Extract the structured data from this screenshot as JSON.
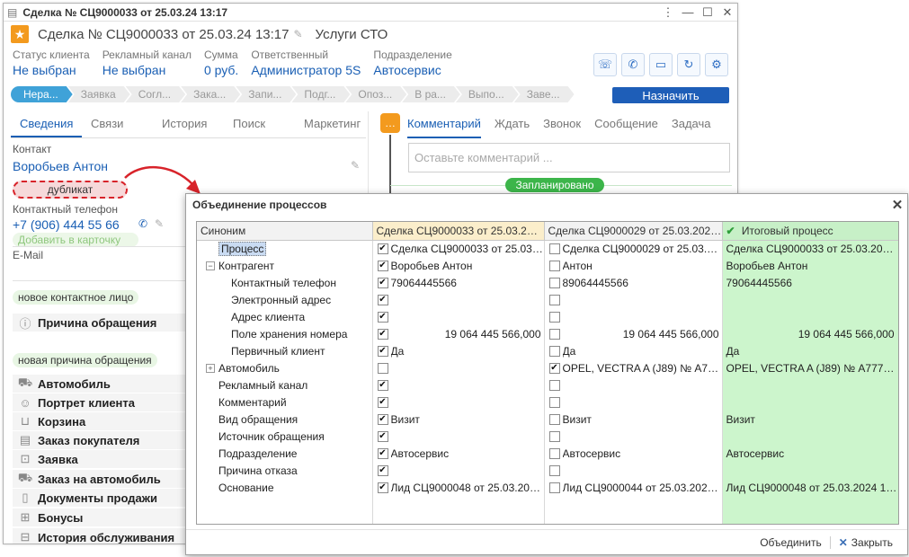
{
  "window": {
    "title": "Сделка № СЦ9000033 от 25.03.24 13:17"
  },
  "header": {
    "doc_title": "Сделка № СЦ9000033 от 25.03.24 13:17",
    "service": "Услуги СТО"
  },
  "fields": [
    {
      "label": "Статус клиента",
      "value": "Не выбран"
    },
    {
      "label": "Рекламный канал",
      "value": "Не выбран"
    },
    {
      "label": "Сумма",
      "value": "0 руб."
    },
    {
      "label": "Ответственный",
      "value": "Администратор 5S"
    },
    {
      "label": "Подразделение",
      "value": "Автосервис"
    }
  ],
  "stages": [
    "Нера...",
    "Заявка",
    "Согл...",
    "Зака...",
    "Запи...",
    "Подг...",
    "Опоз...",
    "В ра...",
    "Выпо...",
    "Заве..."
  ],
  "assign_button": "Назначить",
  "left_tabs": [
    "Сведения",
    "Связи",
    "История",
    "Поиск",
    "Маркетинг"
  ],
  "right_tabs": [
    "Комментарий",
    "Ждать",
    "Звонок",
    "Сообщение",
    "Задача"
  ],
  "comment_placeholder": "Оставьте комментарий ...",
  "planned_label": "Запланировано",
  "contact": {
    "label": "Контакт",
    "name": "Воробьев Антон",
    "duplicate": "дубликат",
    "phone_label": "Контактный телефон",
    "phone": "+7 (906) 444 55 66",
    "add_card": "Добавить в карточку",
    "email_label": "E-Mail",
    "new_contact": "новое контактное лицо",
    "reason_header": "Причина обращения",
    "new_reason": "новая причина обращения"
  },
  "sections": [
    {
      "label": "Автомобиль",
      "icon": "car-icon"
    },
    {
      "label": "Портрет клиента",
      "icon": "person-icon"
    },
    {
      "label": "Корзина",
      "icon": "cart-icon"
    },
    {
      "label": "Заказ покупателя",
      "icon": "document-icon"
    },
    {
      "label": "Заявка",
      "icon": "inbox-icon"
    },
    {
      "label": "Заказ на автомобиль",
      "icon": "car-order-icon"
    },
    {
      "label": "Документы продажи",
      "icon": "clipboard-icon"
    },
    {
      "label": "Бонусы",
      "icon": "gift-icon"
    },
    {
      "label": "История обслуживания",
      "icon": "history-icon"
    }
  ],
  "dialog": {
    "title": "Объединение процессов",
    "columns": {
      "synonym": "Синоним",
      "deal1": "Сделка СЦ9000033 от 25.03.2024 1...",
      "deal2": "Сделка СЦ9000029 от 25.03.2024 11...",
      "final": "Итоговый процесс"
    },
    "rows": [
      {
        "name": "Процесс",
        "level": 0,
        "sel": true,
        "c1": true,
        "v1": "Сделка СЦ9000033 от 25.03.202...",
        "c2": false,
        "v2": "Сделка СЦ9000029 от 25.03.2024 1...",
        "fin": "Сделка СЦ9000033 от 25.03.2024 13:..."
      },
      {
        "name": "Контрагент",
        "level": 0,
        "expand": "−",
        "c1": true,
        "v1": "Воробьев Антон",
        "c2": false,
        "v2": "Антон",
        "fin": "Воробьев Антон"
      },
      {
        "name": "Контактный телефон",
        "level": 1,
        "c1": true,
        "v1": "79064445566",
        "c2": false,
        "v2": "89064445566",
        "fin": "79064445566"
      },
      {
        "name": "Электронный адрес",
        "level": 1,
        "c1": true,
        "v1": "",
        "c2": false,
        "v2": "",
        "fin": ""
      },
      {
        "name": "Адрес клиента",
        "level": 1,
        "c1": true,
        "v1": "",
        "c2": false,
        "v2": "",
        "fin": ""
      },
      {
        "name": "Поле хранения номера",
        "level": 1,
        "c1": true,
        "v1": "19 064 445 566,000",
        "num": true,
        "c2": false,
        "v2": "19 064 445 566,000",
        "fin": "19 064 445 566,000"
      },
      {
        "name": "Первичный клиент",
        "level": 1,
        "c1": true,
        "v1": "Да",
        "c2": false,
        "v2": "Да",
        "fin": "Да"
      },
      {
        "name": "Автомобиль",
        "level": 0,
        "expand": "+",
        "c1": false,
        "v1": "",
        "c2": true,
        "v2": "OPEL, VECTRA A (J89) № А777АА...",
        "fin": "OPEL, VECTRA A (J89) № А777АА77..."
      },
      {
        "name": "Рекламный канал",
        "level": 0,
        "c1": true,
        "v1": "",
        "c2": false,
        "v2": "",
        "fin": ""
      },
      {
        "name": "Комментарий",
        "level": 0,
        "c1": true,
        "v1": "",
        "c2": false,
        "v2": "",
        "fin": ""
      },
      {
        "name": "Вид обращения",
        "level": 0,
        "c1": true,
        "v1": "Визит",
        "c2": false,
        "v2": "Визит",
        "fin": "Визит"
      },
      {
        "name": "Источник обращения",
        "level": 0,
        "c1": true,
        "v1": "",
        "c2": false,
        "v2": "",
        "fin": ""
      },
      {
        "name": "Подразделение",
        "level": 0,
        "c1": true,
        "v1": "Автосервис",
        "c2": false,
        "v2": "Автосервис",
        "fin": "Автосервис"
      },
      {
        "name": "Причина отказа",
        "level": 0,
        "c1": true,
        "v1": "",
        "c2": false,
        "v2": "",
        "fin": ""
      },
      {
        "name": "Основание",
        "level": 0,
        "c1": true,
        "v1": "Лид СЦ9000048 от 25.03.2024 1...",
        "c2": false,
        "v2": "Лид СЦ9000044 от 25.03.2024 11:...",
        "fin": "Лид СЦ9000048 от 25.03.2024 13:17..."
      }
    ],
    "merge_button": "Объединить",
    "close_button": "Закрыть"
  },
  "colors": {
    "accent": "#1a5fb4",
    "final_bg": "#ccf5cc",
    "duplicate_border": "#d8232a",
    "logo": "#f39a1e"
  }
}
